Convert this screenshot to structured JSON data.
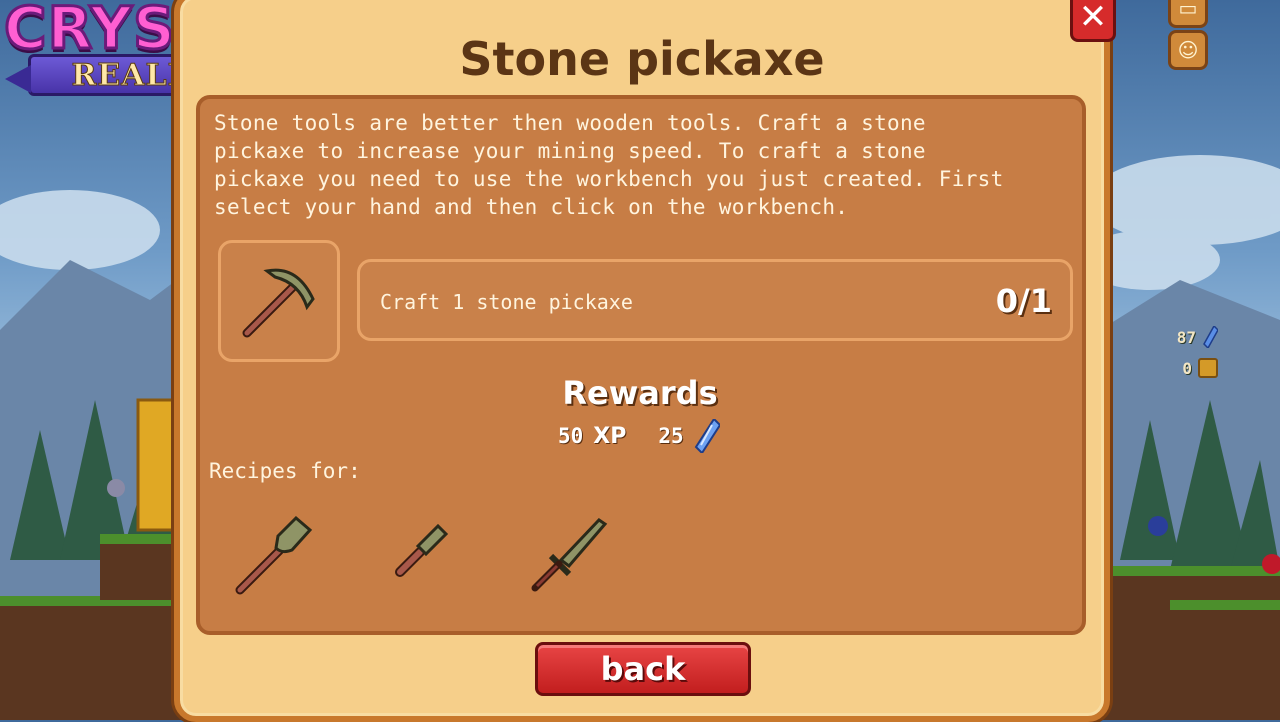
{
  "logo": {
    "title": "CRYSTAL",
    "subtitle": "REALMS"
  },
  "hud": {
    "chat_icon": "chat-bubble-icon",
    "emote_icon": "smiley-icon",
    "gems": "87",
    "coins": "0"
  },
  "dialog": {
    "title": "Stone pickaxe",
    "description": "Stone tools are better then wooden tools. Craft a stone\npickaxe to increase your mining speed. To craft a stone\npickaxe you need to use the workbench you just created. First\nselect your hand and then click on the workbench.",
    "task": {
      "text": "Craft 1 stone pickaxe",
      "progress": "0/1",
      "icon": "stone-pickaxe-icon"
    },
    "rewards_title": "Rewards",
    "rewards": {
      "xp_value": "50",
      "xp_label": "XP",
      "gems_value": "25"
    },
    "recipes_label": "Recipes for:",
    "recipes": [
      "stone-shovel-icon",
      "stone-chisel-icon",
      "stone-sword-icon"
    ],
    "back_label": "back",
    "close_label": "✕"
  },
  "colors": {
    "panel": "#f6cf8a",
    "inner": "#c77d45",
    "button": "#d62b2b",
    "title": "#5b3515"
  }
}
